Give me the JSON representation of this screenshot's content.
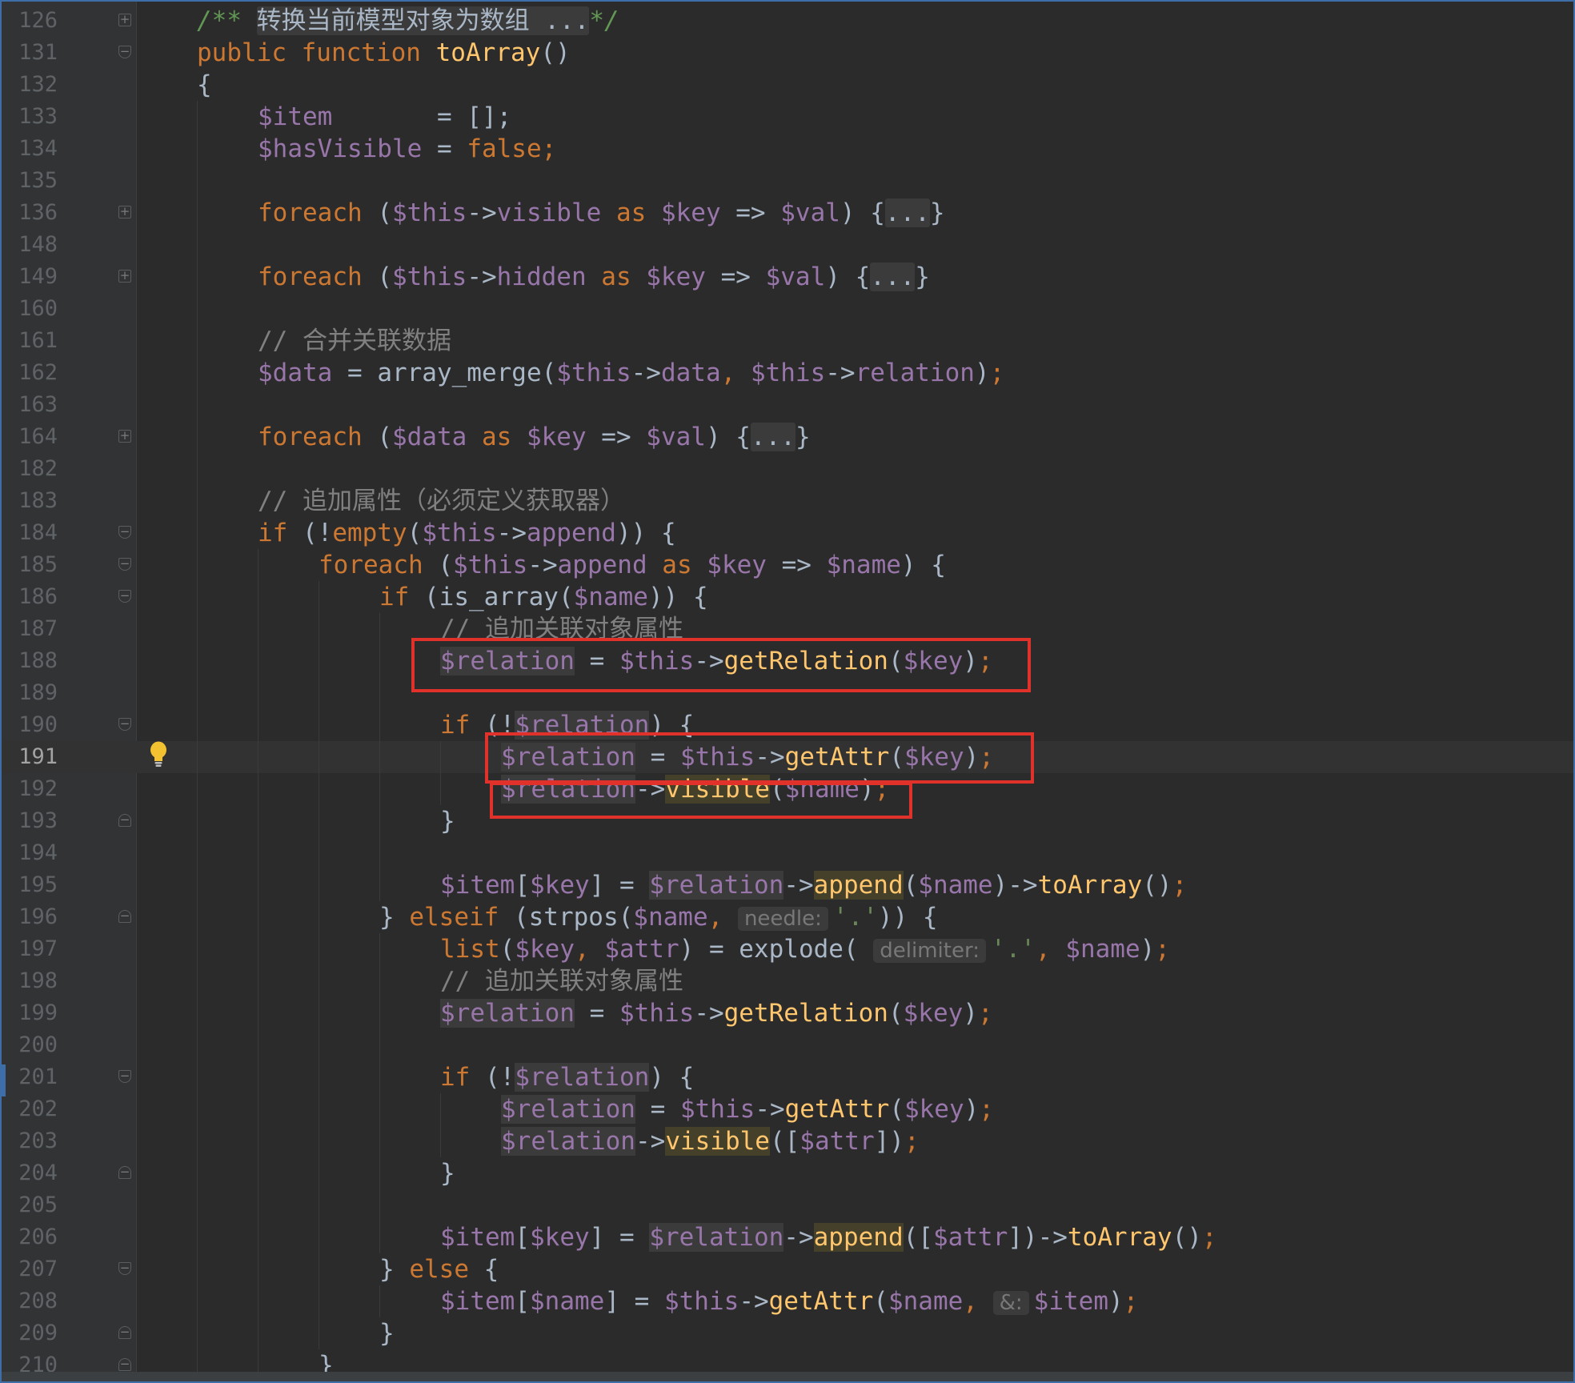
{
  "editor": {
    "lines": [
      {
        "n": "126",
        "fold": "plus",
        "indent": 2,
        "tokens": [
          [
            "doc",
            "/** "
          ],
          [
            "docfold",
            "转换当前模型对象为数组 ..."
          ],
          [
            "doc",
            "*/"
          ]
        ]
      },
      {
        "n": "131",
        "fold": "open",
        "indent": 2,
        "tokens": [
          [
            "kw",
            "public function "
          ],
          [
            "fn",
            "toArray"
          ],
          [
            "pl",
            "()"
          ]
        ]
      },
      {
        "n": "132",
        "fold": "",
        "indent": 2,
        "tokens": [
          [
            "pl",
            "{"
          ]
        ]
      },
      {
        "n": "133",
        "fold": "",
        "indent": 3,
        "tokens": [
          [
            "var",
            "$item"
          ],
          [
            "pl",
            "       = [];"
          ]
        ]
      },
      {
        "n": "134",
        "fold": "",
        "indent": 3,
        "tokens": [
          [
            "var",
            "$hasVisible"
          ],
          [
            "pl",
            " = "
          ],
          [
            "kw",
            "false"
          ],
          [
            "kw",
            ";"
          ]
        ]
      },
      {
        "n": "135",
        "fold": "",
        "indent": 3,
        "tokens": []
      },
      {
        "n": "136",
        "fold": "plus",
        "indent": 3,
        "tokens": [
          [
            "kw",
            "foreach "
          ],
          [
            "pl",
            "("
          ],
          [
            "var",
            "$this"
          ],
          [
            "pl",
            "->"
          ],
          [
            "var",
            "visible"
          ],
          [
            "kw",
            " as "
          ],
          [
            "var",
            "$key"
          ],
          [
            "pl",
            " => "
          ],
          [
            "var",
            "$val"
          ],
          [
            "pl",
            ") {"
          ],
          [
            "box",
            "..."
          ],
          [
            "pl",
            "}"
          ]
        ]
      },
      {
        "n": "148",
        "fold": "",
        "indent": 3,
        "tokens": []
      },
      {
        "n": "149",
        "fold": "plus",
        "indent": 3,
        "tokens": [
          [
            "kw",
            "foreach "
          ],
          [
            "pl",
            "("
          ],
          [
            "var",
            "$this"
          ],
          [
            "pl",
            "->"
          ],
          [
            "var",
            "hidden"
          ],
          [
            "kw",
            " as "
          ],
          [
            "var",
            "$key"
          ],
          [
            "pl",
            " => "
          ],
          [
            "var",
            "$val"
          ],
          [
            "pl",
            ") {"
          ],
          [
            "box",
            "..."
          ],
          [
            "pl",
            "}"
          ]
        ]
      },
      {
        "n": "160",
        "fold": "",
        "indent": 3,
        "tokens": []
      },
      {
        "n": "161",
        "fold": "",
        "indent": 3,
        "tokens": [
          [
            "cm",
            "// 合并关联数据"
          ]
        ]
      },
      {
        "n": "162",
        "fold": "",
        "indent": 3,
        "tokens": [
          [
            "var",
            "$data"
          ],
          [
            "pl",
            " = array_merge("
          ],
          [
            "var",
            "$this"
          ],
          [
            "pl",
            "->"
          ],
          [
            "var",
            "data"
          ],
          [
            "kw",
            ", "
          ],
          [
            "var",
            "$this"
          ],
          [
            "pl",
            "->"
          ],
          [
            "var",
            "relation"
          ],
          [
            "pl",
            ")"
          ],
          [
            "kw",
            ";"
          ]
        ]
      },
      {
        "n": "163",
        "fold": "",
        "indent": 3,
        "tokens": []
      },
      {
        "n": "164",
        "fold": "plus",
        "indent": 3,
        "tokens": [
          [
            "kw",
            "foreach "
          ],
          [
            "pl",
            "("
          ],
          [
            "var",
            "$data"
          ],
          [
            "kw",
            " as "
          ],
          [
            "var",
            "$key"
          ],
          [
            "pl",
            " => "
          ],
          [
            "var",
            "$val"
          ],
          [
            "pl",
            ") {"
          ],
          [
            "box",
            "..."
          ],
          [
            "pl",
            "}"
          ]
        ]
      },
      {
        "n": "182",
        "fold": "",
        "indent": 3,
        "tokens": []
      },
      {
        "n": "183",
        "fold": "",
        "indent": 3,
        "tokens": [
          [
            "cm",
            "// 追加属性（必须定义获取器）"
          ]
        ]
      },
      {
        "n": "184",
        "fold": "open",
        "indent": 3,
        "tokens": [
          [
            "kw",
            "if "
          ],
          [
            "pl",
            "(!"
          ],
          [
            "kw",
            "empty"
          ],
          [
            "pl",
            "("
          ],
          [
            "var",
            "$this"
          ],
          [
            "pl",
            "->"
          ],
          [
            "var",
            "append"
          ],
          [
            "pl",
            ")) {"
          ]
        ]
      },
      {
        "n": "185",
        "fold": "open",
        "indent": 4,
        "tokens": [
          [
            "kw",
            "foreach "
          ],
          [
            "pl",
            "("
          ],
          [
            "var",
            "$this"
          ],
          [
            "pl",
            "->"
          ],
          [
            "var",
            "append"
          ],
          [
            "kw",
            " as "
          ],
          [
            "var",
            "$key"
          ],
          [
            "pl",
            " => "
          ],
          [
            "var",
            "$name"
          ],
          [
            "pl",
            ") {"
          ]
        ]
      },
      {
        "n": "186",
        "fold": "open",
        "indent": 5,
        "tokens": [
          [
            "kw",
            "if "
          ],
          [
            "pl",
            "(is_array("
          ],
          [
            "var",
            "$name"
          ],
          [
            "pl",
            ")) {"
          ]
        ]
      },
      {
        "n": "187",
        "fold": "",
        "indent": 6,
        "tokens": [
          [
            "cm",
            "// 追加关联对象属性"
          ]
        ]
      },
      {
        "n": "188",
        "fold": "",
        "indent": 6,
        "tokens": [
          [
            "hvar",
            "$relation"
          ],
          [
            "pl",
            " = "
          ],
          [
            "var",
            "$this"
          ],
          [
            "pl",
            "->"
          ],
          [
            "fn",
            "getRelation"
          ],
          [
            "pl",
            "("
          ],
          [
            "var",
            "$key"
          ],
          [
            "pl",
            ")"
          ],
          [
            "kw",
            ";"
          ]
        ]
      },
      {
        "n": "189",
        "fold": "",
        "indent": 6,
        "tokens": []
      },
      {
        "n": "190",
        "fold": "open",
        "indent": 6,
        "tokens": [
          [
            "kw",
            "if "
          ],
          [
            "pl",
            "(!"
          ],
          [
            "hvar",
            "$relation"
          ],
          [
            "pl",
            ") {"
          ]
        ]
      },
      {
        "n": "191",
        "fold": "",
        "indent": 7,
        "current": true,
        "tokens": [
          [
            "hvar",
            "$relation"
          ],
          [
            "pl",
            " = "
          ],
          [
            "var",
            "$this"
          ],
          [
            "pl",
            "->"
          ],
          [
            "fn",
            "getAttr"
          ],
          [
            "pl",
            "("
          ],
          [
            "var",
            "$key"
          ],
          [
            "pl",
            ")"
          ],
          [
            "kw",
            ";"
          ]
        ]
      },
      {
        "n": "192",
        "fold": "",
        "indent": 7,
        "tokens": [
          [
            "hvar",
            "$relation"
          ],
          [
            "pl",
            "->"
          ],
          [
            "hfn",
            "visible"
          ],
          [
            "pl",
            "("
          ],
          [
            "var",
            "$name"
          ],
          [
            "pl",
            ")"
          ],
          [
            "kw",
            ";"
          ]
        ]
      },
      {
        "n": "193",
        "fold": "close",
        "indent": 6,
        "tokens": [
          [
            "pl",
            "}"
          ]
        ]
      },
      {
        "n": "194",
        "fold": "",
        "indent": 6,
        "tokens": []
      },
      {
        "n": "195",
        "fold": "",
        "indent": 6,
        "tokens": [
          [
            "var",
            "$item"
          ],
          [
            "pl",
            "["
          ],
          [
            "var",
            "$key"
          ],
          [
            "pl",
            "] = "
          ],
          [
            "hvar",
            "$relation"
          ],
          [
            "pl",
            "->"
          ],
          [
            "hfn",
            "append"
          ],
          [
            "pl",
            "("
          ],
          [
            "var",
            "$name"
          ],
          [
            "pl",
            ")->"
          ],
          [
            "fn",
            "toArray"
          ],
          [
            "pl",
            "()"
          ],
          [
            "kw",
            ";"
          ]
        ]
      },
      {
        "n": "196",
        "fold": "close",
        "indent": 5,
        "tokens": [
          [
            "pl",
            "} "
          ],
          [
            "kw",
            "elseif "
          ],
          [
            "pl",
            "(strpos("
          ],
          [
            "var",
            "$name"
          ],
          [
            "kw",
            ", "
          ],
          [
            "hint",
            "needle:"
          ],
          [
            "str",
            "'.'"
          ],
          [
            "pl",
            ")) {"
          ]
        ]
      },
      {
        "n": "197",
        "fold": "",
        "indent": 6,
        "tokens": [
          [
            "kw",
            "list"
          ],
          [
            "pl",
            "("
          ],
          [
            "var",
            "$key"
          ],
          [
            "kw",
            ", "
          ],
          [
            "var",
            "$attr"
          ],
          [
            "pl",
            ") = explode( "
          ],
          [
            "hint",
            "delimiter:"
          ],
          [
            "str",
            "'.'"
          ],
          [
            "kw",
            ", "
          ],
          [
            "var",
            "$name"
          ],
          [
            "pl",
            ")"
          ],
          [
            "kw",
            ";"
          ]
        ]
      },
      {
        "n": "198",
        "fold": "",
        "indent": 6,
        "tokens": [
          [
            "cm",
            "// 追加关联对象属性"
          ]
        ]
      },
      {
        "n": "199",
        "fold": "",
        "indent": 6,
        "tokens": [
          [
            "hvar",
            "$relation"
          ],
          [
            "pl",
            " = "
          ],
          [
            "var",
            "$this"
          ],
          [
            "pl",
            "->"
          ],
          [
            "fn",
            "getRelation"
          ],
          [
            "pl",
            "("
          ],
          [
            "var",
            "$key"
          ],
          [
            "pl",
            ")"
          ],
          [
            "kw",
            ";"
          ]
        ]
      },
      {
        "n": "200",
        "fold": "",
        "indent": 6,
        "tokens": []
      },
      {
        "n": "201",
        "fold": "open",
        "indent": 6,
        "tokens": [
          [
            "kw",
            "if "
          ],
          [
            "pl",
            "(!"
          ],
          [
            "hvar",
            "$relation"
          ],
          [
            "pl",
            ") {"
          ]
        ]
      },
      {
        "n": "202",
        "fold": "",
        "indent": 7,
        "tokens": [
          [
            "hvar",
            "$relation"
          ],
          [
            "pl",
            " = "
          ],
          [
            "var",
            "$this"
          ],
          [
            "pl",
            "->"
          ],
          [
            "fn",
            "getAttr"
          ],
          [
            "pl",
            "("
          ],
          [
            "var",
            "$key"
          ],
          [
            "pl",
            ")"
          ],
          [
            "kw",
            ";"
          ]
        ]
      },
      {
        "n": "203",
        "fold": "",
        "indent": 7,
        "tokens": [
          [
            "hvar",
            "$relation"
          ],
          [
            "pl",
            "->"
          ],
          [
            "hfn",
            "visible"
          ],
          [
            "pl",
            "(["
          ],
          [
            "var",
            "$attr"
          ],
          [
            "pl",
            "])"
          ],
          [
            "kw",
            ";"
          ]
        ]
      },
      {
        "n": "204",
        "fold": "close",
        "indent": 6,
        "tokens": [
          [
            "pl",
            "}"
          ]
        ]
      },
      {
        "n": "205",
        "fold": "",
        "indent": 6,
        "tokens": []
      },
      {
        "n": "206",
        "fold": "",
        "indent": 6,
        "tokens": [
          [
            "var",
            "$item"
          ],
          [
            "pl",
            "["
          ],
          [
            "var",
            "$key"
          ],
          [
            "pl",
            "] = "
          ],
          [
            "hvar",
            "$relation"
          ],
          [
            "pl",
            "->"
          ],
          [
            "hfn",
            "append"
          ],
          [
            "pl",
            "(["
          ],
          [
            "var",
            "$attr"
          ],
          [
            "pl",
            "])->"
          ],
          [
            "fn",
            "toArray"
          ],
          [
            "pl",
            "()"
          ],
          [
            "kw",
            ";"
          ]
        ]
      },
      {
        "n": "207",
        "fold": "open",
        "indent": 5,
        "tokens": [
          [
            "pl",
            "} "
          ],
          [
            "kw",
            "else "
          ],
          [
            "pl",
            "{"
          ]
        ]
      },
      {
        "n": "208",
        "fold": "",
        "indent": 6,
        "tokens": [
          [
            "var",
            "$item"
          ],
          [
            "pl",
            "["
          ],
          [
            "var",
            "$name"
          ],
          [
            "pl",
            "] = "
          ],
          [
            "var",
            "$this"
          ],
          [
            "pl",
            "->"
          ],
          [
            "fn",
            "getAttr"
          ],
          [
            "pl",
            "("
          ],
          [
            "var",
            "$name"
          ],
          [
            "kw",
            ", "
          ],
          [
            "hint",
            "&:"
          ],
          [
            "var",
            "$item"
          ],
          [
            "pl",
            ")"
          ],
          [
            "kw",
            ";"
          ]
        ]
      },
      {
        "n": "209",
        "fold": "close",
        "indent": 5,
        "tokens": [
          [
            "pl",
            "}"
          ]
        ]
      },
      {
        "n": "210",
        "fold": "close",
        "indent": 4,
        "tokens": [
          [
            "pl",
            "}"
          ]
        ]
      }
    ]
  },
  "colors": {
    "background": "#2b2b2b",
    "keyword": "#cc7832",
    "function": "#ffc66d",
    "variable": "#9876aa",
    "comment": "#808080",
    "doc_comment": "#629755",
    "string": "#6a8759",
    "plain": "#a9b7c6",
    "annotation_box": "#e0312b"
  },
  "icons": {
    "intention": "lightbulb-icon",
    "fold_expand": "fold-plus-icon",
    "fold_collapse": "fold-minus-icon"
  }
}
